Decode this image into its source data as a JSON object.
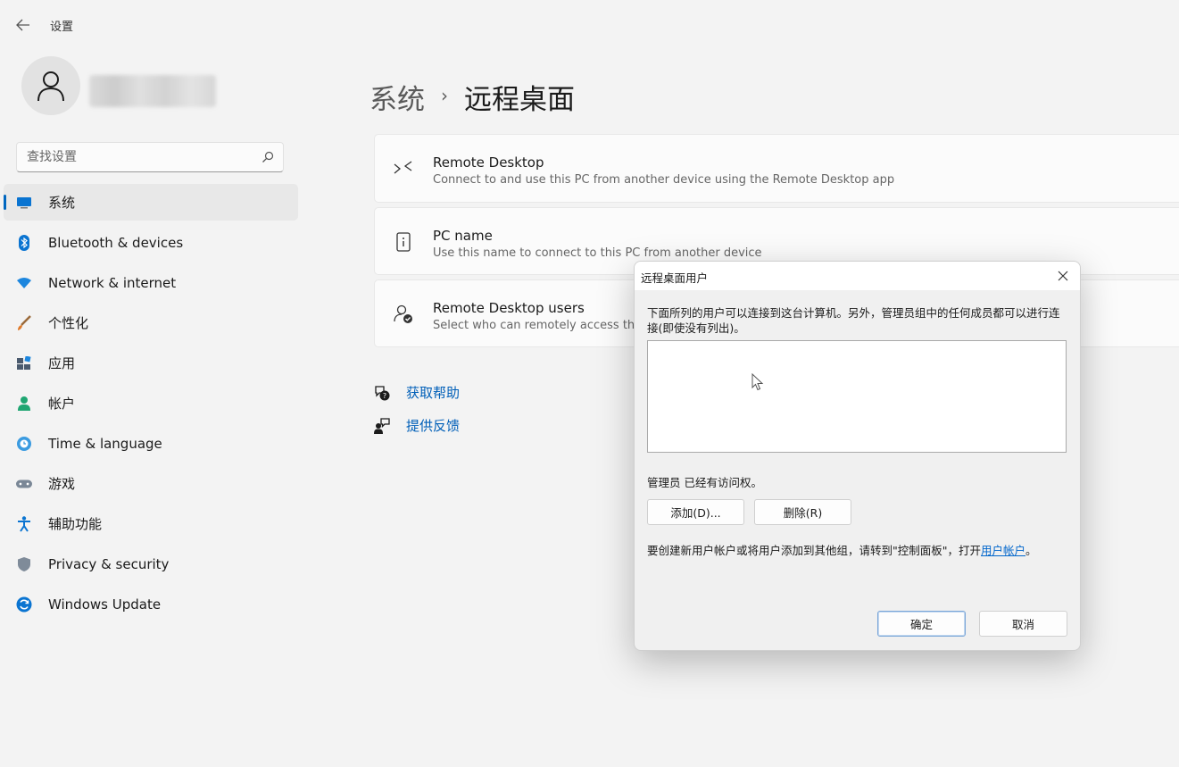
{
  "window": {
    "app_title": "设置"
  },
  "search": {
    "placeholder": "查找设置"
  },
  "nav": {
    "items": [
      {
        "label": "系统",
        "icon": "system-icon",
        "active": true
      },
      {
        "label": "Bluetooth & devices",
        "icon": "bluetooth-icon"
      },
      {
        "label": "Network & internet",
        "icon": "wifi-icon"
      },
      {
        "label": "个性化",
        "icon": "brush-icon"
      },
      {
        "label": "应用",
        "icon": "apps-icon"
      },
      {
        "label": "帐户",
        "icon": "account-icon"
      },
      {
        "label": "Time & language",
        "icon": "globe-clock-icon"
      },
      {
        "label": "游戏",
        "icon": "gamepad-icon"
      },
      {
        "label": "辅助功能",
        "icon": "accessibility-icon"
      },
      {
        "label": "Privacy & security",
        "icon": "shield-icon"
      },
      {
        "label": "Windows Update",
        "icon": "update-icon"
      }
    ]
  },
  "header": {
    "crumb_parent": "系统",
    "crumb_separator": "›",
    "crumb_current": "远程桌面"
  },
  "cards": [
    {
      "title": "Remote Desktop",
      "subtitle": "Connect to and use this PC from another device using the Remote Desktop app",
      "icon": "remote-desktop-icon"
    },
    {
      "title": "PC name",
      "subtitle": "Use this name to connect to this PC from another device",
      "icon": "pc-info-icon"
    },
    {
      "title": "Remote Desktop users",
      "subtitle": "Select who can remotely access this PC",
      "icon": "users-check-icon"
    }
  ],
  "links": [
    {
      "label": "获取帮助",
      "icon": "help-icon"
    },
    {
      "label": "提供反馈",
      "icon": "feedback-icon"
    }
  ],
  "dialog": {
    "title": "远程桌面用户",
    "description": "下面所列的用户可以连接到这台计算机。另外，管理员组中的任何成员都可以进行连接(即使没有列出)。",
    "admin_text": "管理员 已经有访问权。",
    "add_label": "添加(D)...",
    "remove_label": "删除(R)",
    "note_text": "要创建新用户帐户或将用户添加到其他组，请转到\"控制面板\"，打开",
    "note_link": "用户帐户",
    "note_end": "。",
    "ok_label": "确定",
    "cancel_label": "取消"
  },
  "colors": {
    "accent": "#0067c0",
    "link": "#005fb8"
  }
}
